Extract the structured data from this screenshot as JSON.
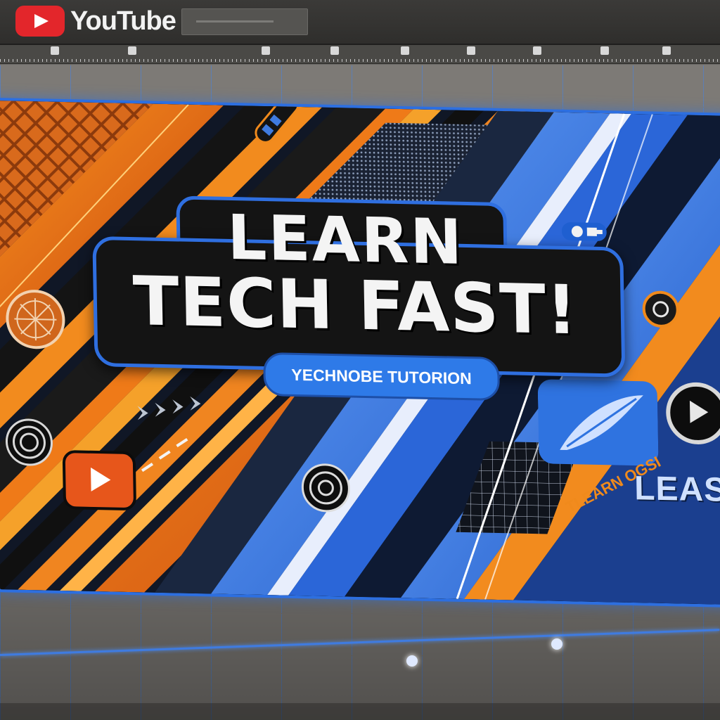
{
  "app": {
    "brand": "YouTube",
    "logo_icon": "youtube-logo-icon"
  },
  "search": {
    "placeholder": ""
  },
  "banner": {
    "title_line1": "LEARN",
    "title_line2": "TECH FAST!",
    "subtitle": "YECHNOBE TUTORION",
    "side_text_right": "LEASI",
    "side_text_rotated": "TLEARN OGSI",
    "icons": [
      "youtube-play-icon",
      "play-button-icon",
      "lock-icon",
      "target-icon",
      "compass-icon",
      "feather-icon"
    ]
  },
  "colors": {
    "accent_blue": "#2f6fe0",
    "accent_orange": "#f07a1a",
    "youtube_red": "#e3262b",
    "plate_dark": "#141414"
  }
}
